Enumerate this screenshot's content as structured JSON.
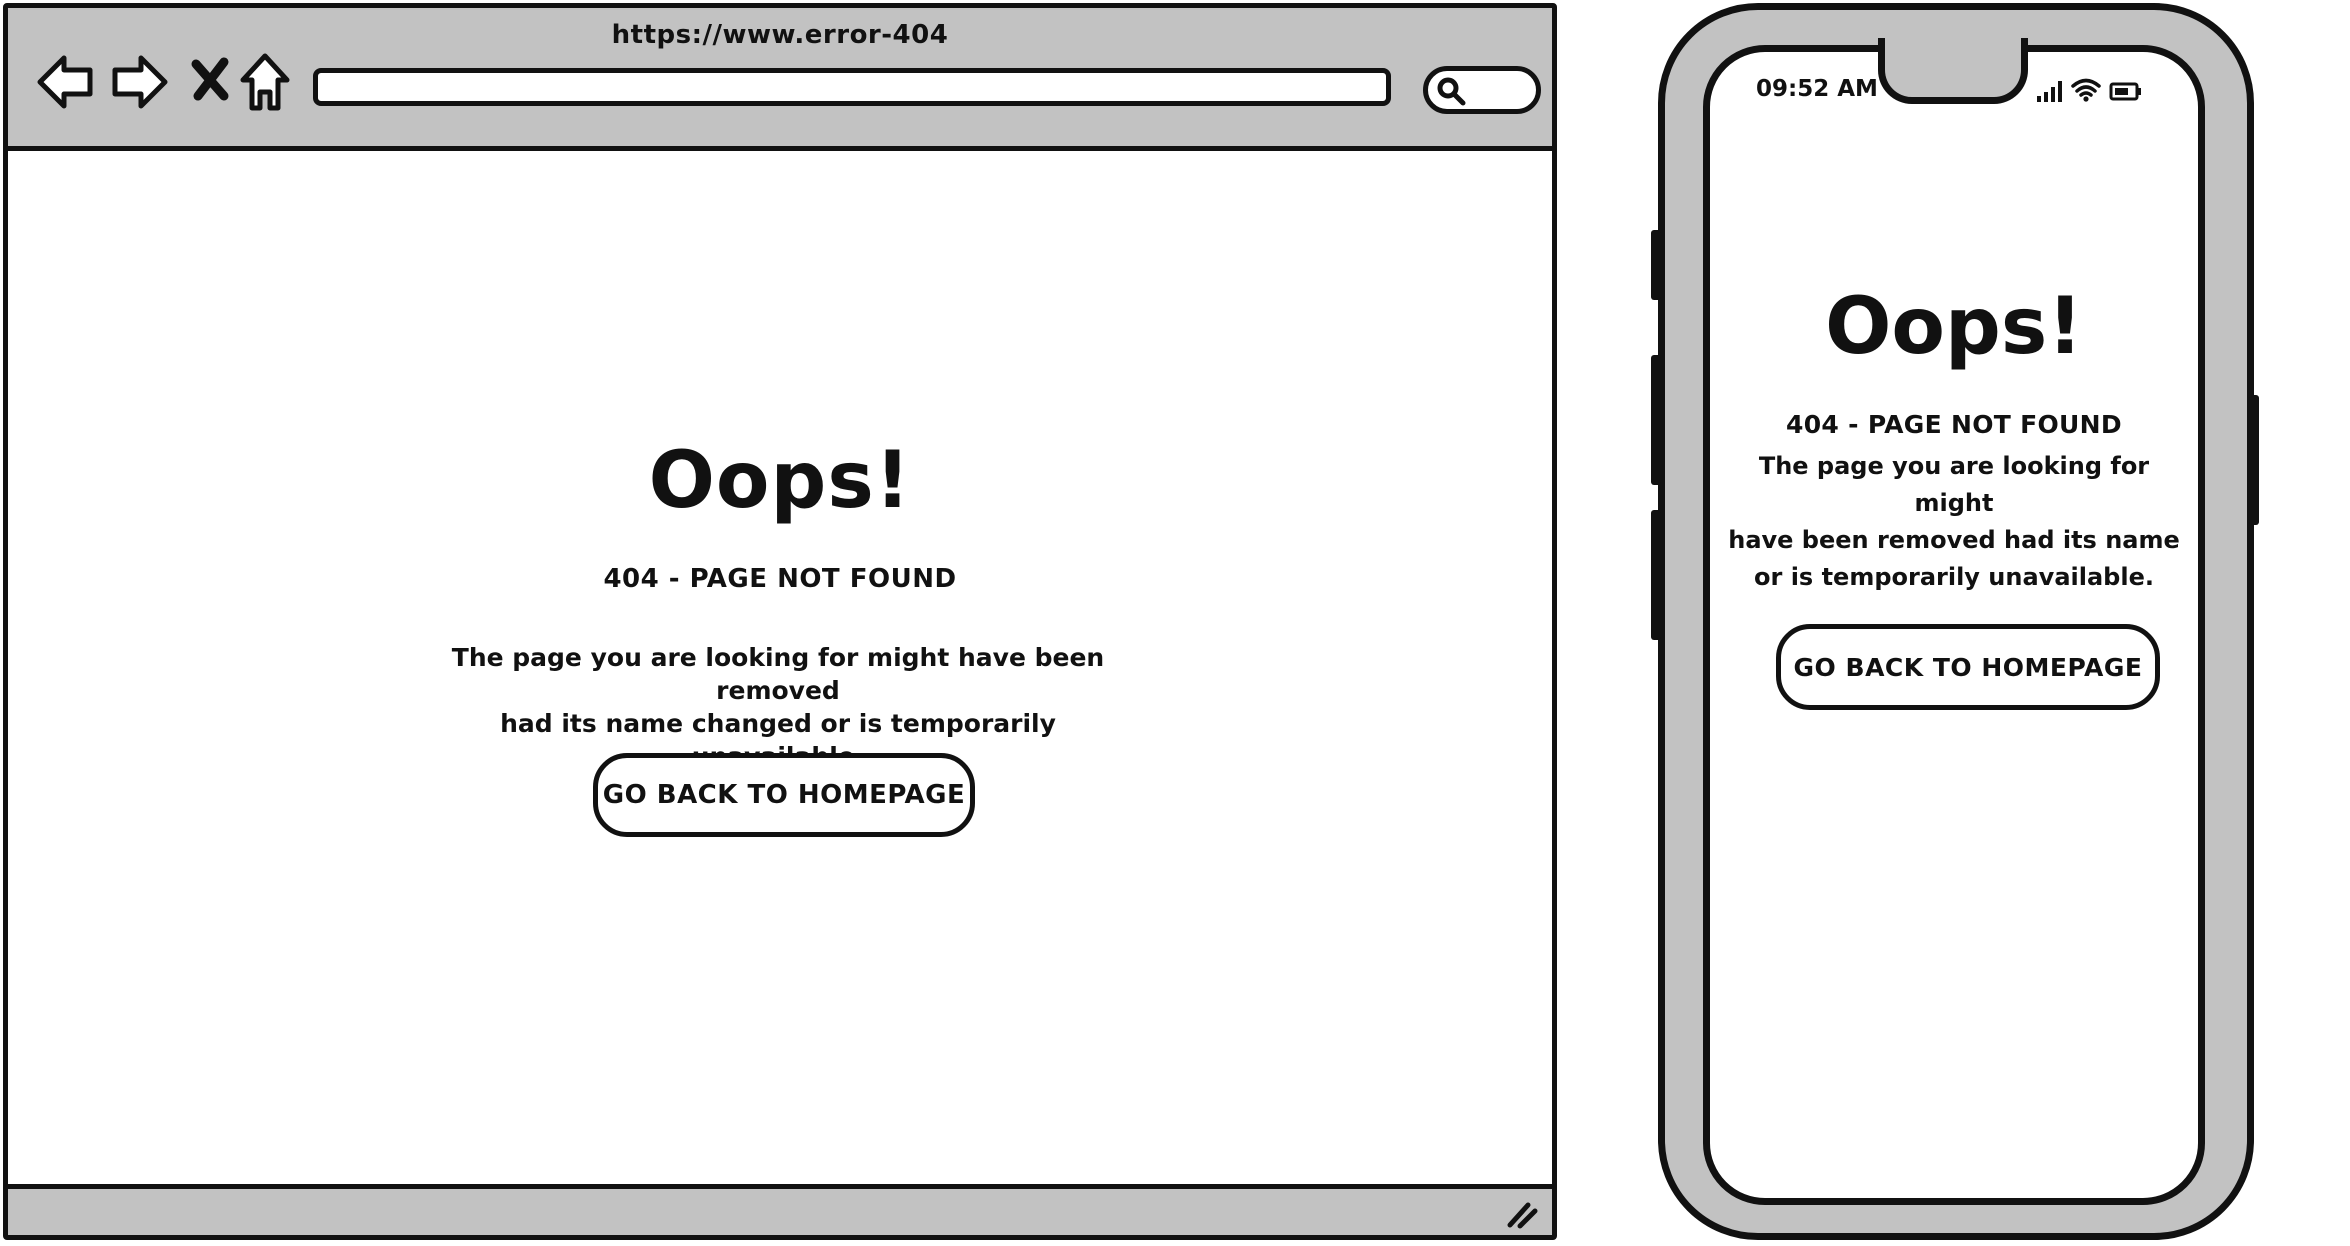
{
  "browser": {
    "url": "https://www.error-404",
    "content": {
      "title": "Oops!",
      "subtitle": "404 - PAGE NOT FOUND",
      "message_line1": "The page you are looking for might have been removed",
      "message_line2": "had its name changed or is temporarily unavailable.",
      "button_label": "GO BACK TO HOMEPAGE"
    }
  },
  "phone": {
    "status_time": "09:52 AM",
    "content": {
      "title": "Oops!",
      "subtitle": "404 - PAGE NOT FOUND",
      "message_line1": "The page you are looking for might",
      "message_line2": "have been removed had its name",
      "message_line3": "or is temporarily unavailable.",
      "button_label": "GO BACK TO HOMEPAGE"
    }
  },
  "icons": {
    "back": "arrow-left-icon",
    "forward": "arrow-right-icon",
    "stop": "close-icon",
    "home": "home-icon",
    "search": "search-icon",
    "resize": "resize-grip-icon",
    "signal": "signal-icon",
    "wifi": "wifi-icon",
    "battery": "battery-icon"
  },
  "colors": {
    "chrome_gray": "#c2c2c2",
    "stroke": "#111111",
    "surface": "#ffffff"
  }
}
